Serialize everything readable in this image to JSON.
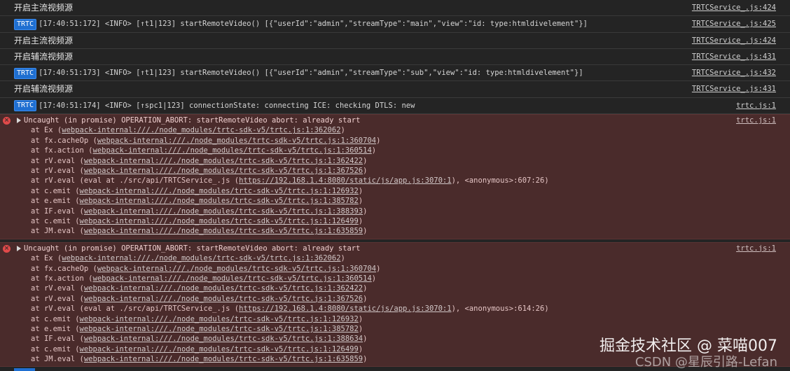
{
  "logs": [
    {
      "badge": "",
      "text": "开启主流视频源",
      "src": "TRTCService_.js:424"
    },
    {
      "badge": "TRTC",
      "text": "[17:40:51:172] <INFO> [↑t1|123] startRemoteVideo() [{\"userId\":\"admin\",\"streamType\":\"main\",\"view\":\"id:  type:htmldivelement\"}]",
      "src": "TRTCService_.js:425"
    },
    {
      "badge": "",
      "text": "开启主流视频源",
      "src": "TRTCService_.js:424"
    },
    {
      "badge": "",
      "text": "开启辅流视频源",
      "src": "TRTCService_.js:431"
    },
    {
      "badge": "TRTC",
      "text": "[17:40:51:173] <INFO> [↑t1|123] startRemoteVideo() [{\"userId\":\"admin\",\"streamType\":\"sub\",\"view\":\"id:  type:htmldivelement\"}]",
      "src": "TRTCService_.js:432"
    },
    {
      "badge": "",
      "text": "开启辅流视频源",
      "src": "TRTCService_.js:431"
    },
    {
      "badge": "TRTC",
      "text": "[17:40:51:174] <INFO> [↑spc1|123] connectionState: connecting ICE: checking DTLS: new",
      "src": "trtc.js:1"
    }
  ],
  "errors": [
    {
      "header": "Uncaught (in promise) OPERATION_ABORT: startRemoteVideo abort: already start",
      "src": "trtc.js:1",
      "frames": [
        {
          "pre": "at Ex (",
          "link": "webpack-internal:///./node_modules/trtc-sdk-v5/trtc.js:1:362062",
          "post": ")"
        },
        {
          "pre": "at fx.cacheOp (",
          "link": "webpack-internal:///./node_modules/trtc-sdk-v5/trtc.js:1:360704",
          "post": ")"
        },
        {
          "pre": "at fx.action (",
          "link": "webpack-internal:///./node_modules/trtc-sdk-v5/trtc.js:1:360514",
          "post": ")"
        },
        {
          "pre": "at rV.eval (",
          "link": "webpack-internal:///./node_modules/trtc-sdk-v5/trtc.js:1:362422",
          "post": ")"
        },
        {
          "pre": "at rV.eval (",
          "link": "webpack-internal:///./node_modules/trtc-sdk-v5/trtc.js:1:367526",
          "post": ")"
        },
        {
          "pre": "at rV.eval (eval at ./src/api/TRTCService_.js (",
          "link": "https://192.168.1.4:8080/static/js/app.js:3070:1",
          "post": "), <anonymous>:607:26)"
        },
        {
          "pre": "at c.emit (",
          "link": "webpack-internal:///./node_modules/trtc-sdk-v5/trtc.js:1:126932",
          "post": ")"
        },
        {
          "pre": "at e.emit (",
          "link": "webpack-internal:///./node_modules/trtc-sdk-v5/trtc.js:1:385782",
          "post": ")"
        },
        {
          "pre": "at IF.eval (",
          "link": "webpack-internal:///./node_modules/trtc-sdk-v5/trtc.js:1:388393",
          "post": ")"
        },
        {
          "pre": "at c.emit (",
          "link": "webpack-internal:///./node_modules/trtc-sdk-v5/trtc.js:1:126499",
          "post": ")"
        },
        {
          "pre": "at JM.eval (",
          "link": "webpack-internal:///./node_modules/trtc-sdk-v5/trtc.js:1:635859",
          "post": ")"
        }
      ]
    },
    {
      "header": "Uncaught (in promise) OPERATION_ABORT: startRemoteVideo abort: already start",
      "src": "trtc.js:1",
      "frames": [
        {
          "pre": "at Ex (",
          "link": "webpack-internal:///./node_modules/trtc-sdk-v5/trtc.js:1:362062",
          "post": ")"
        },
        {
          "pre": "at fx.cacheOp (",
          "link": "webpack-internal:///./node_modules/trtc-sdk-v5/trtc.js:1:360704",
          "post": ")"
        },
        {
          "pre": "at fx.action (",
          "link": "webpack-internal:///./node_modules/trtc-sdk-v5/trtc.js:1:360514",
          "post": ")"
        },
        {
          "pre": "at rV.eval (",
          "link": "webpack-internal:///./node_modules/trtc-sdk-v5/trtc.js:1:362422",
          "post": ")"
        },
        {
          "pre": "at rV.eval (",
          "link": "webpack-internal:///./node_modules/trtc-sdk-v5/trtc.js:1:367526",
          "post": ")"
        },
        {
          "pre": "at rV.eval (eval at ./src/api/TRTCService_.js (",
          "link": "https://192.168.1.4:8080/static/js/app.js:3070:1",
          "post": "), <anonymous>:614:26)"
        },
        {
          "pre": "at c.emit (",
          "link": "webpack-internal:///./node_modules/trtc-sdk-v5/trtc.js:1:126932",
          "post": ")"
        },
        {
          "pre": "at e.emit (",
          "link": "webpack-internal:///./node_modules/trtc-sdk-v5/trtc.js:1:385782",
          "post": ")"
        },
        {
          "pre": "at IF.eval (",
          "link": "webpack-internal:///./node_modules/trtc-sdk-v5/trtc.js:1:388634",
          "post": ")"
        },
        {
          "pre": "at c.emit (",
          "link": "webpack-internal:///./node_modules/trtc-sdk-v5/trtc.js:1:126499",
          "post": ")"
        },
        {
          "pre": "at JM.eval (",
          "link": "webpack-internal:///./node_modules/trtc-sdk-v5/trtc.js:1:635859",
          "post": ")"
        }
      ]
    }
  ],
  "watermark": {
    "line1": "掘金技术社区 @ 菜喵007",
    "line2": "CSDN @星辰引路-Lefan"
  },
  "colors": {
    "badge": "#1f6fd1",
    "error_bg": "#4a2b2b",
    "console_bg": "#242424"
  }
}
